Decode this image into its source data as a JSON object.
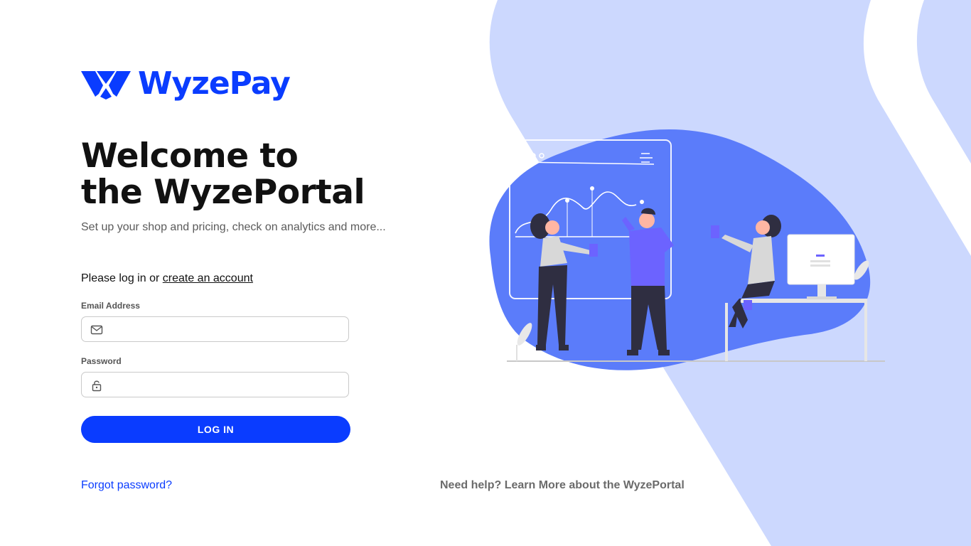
{
  "brand": {
    "name": "WyzePay",
    "color": "#0a3cff",
    "logo_icon": "wyzepay-logo-icon"
  },
  "hero": {
    "title_line1": "Welcome to",
    "title_line2": "the WyzePortal",
    "subtitle": "Set up your shop and pricing, check on analytics and more..."
  },
  "login": {
    "prompt": "Please log in or",
    "create_account_link": "create an account",
    "email_label": "Email Address",
    "email_value": "",
    "email_icon": "mail-icon",
    "password_label": "Password",
    "password_value": "",
    "password_icon": "lock-icon",
    "submit_label": "LOG IN",
    "forgot_link": "Forgot password?"
  },
  "help": {
    "text": "Need help?",
    "link": "Learn More about the WyzePortal"
  },
  "colors": {
    "accent": "#0a3cff",
    "background_shape": "#ccd8fe",
    "blob": "#5b7cfa",
    "figure_purple": "#6c63ff"
  }
}
